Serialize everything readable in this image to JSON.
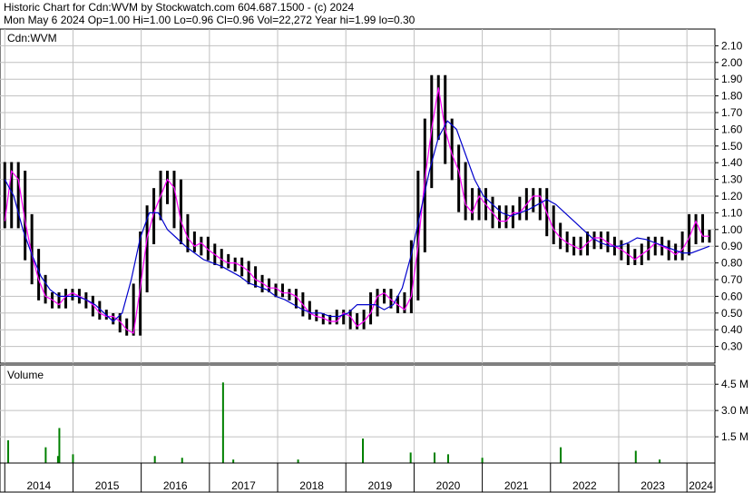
{
  "header": {
    "line1": "Historic Chart for Cdn:WVM by Stockwatch.com 604.687.1500 - (c) 2024",
    "line2": "Mon May  6 2024  Op=1.00  Hi=1.00  Lo=0.96  Cl=0.96  Vol=22,272  Year hi=1.99  lo=0.30"
  },
  "colors": {
    "price_bar": "#000000",
    "ma_short": "#ff00ff",
    "ma_long": "#0000cc",
    "last_price_segment": "#ff0000",
    "volume_default": "#008000",
    "grid": "#c0c0c0"
  },
  "chart_data": [
    {
      "type": "line",
      "label": "Cdn:WVM",
      "ylim": [
        0.2,
        2.2
      ],
      "y_ticks": [
        "2.10",
        "2.00",
        "1.90",
        "1.80",
        "1.70",
        "1.60",
        "1.50",
        "1.40",
        "1.30",
        "1.20",
        "1.10",
        "1.00",
        "0.90",
        "0.80",
        "0.70",
        "0.60",
        "0.50",
        "0.40",
        "0.30"
      ],
      "x_ticks": [
        "2014",
        "2015",
        "2016",
        "2017",
        "2018",
        "2019",
        "2020",
        "2021",
        "2022",
        "2023",
        "2024"
      ],
      "x": [
        2014.0,
        2014.08,
        2014.17,
        2014.25,
        2014.33,
        2014.42,
        2014.5,
        2014.58,
        2014.67,
        2014.75,
        2014.83,
        2014.92,
        2015.0,
        2015.08,
        2015.17,
        2015.25,
        2015.33,
        2015.42,
        2015.5,
        2015.58,
        2015.67,
        2015.75,
        2015.83,
        2015.92,
        2016.0,
        2016.08,
        2016.17,
        2016.25,
        2016.33,
        2016.42,
        2016.5,
        2016.58,
        2016.67,
        2016.75,
        2016.83,
        2016.92,
        2017.0,
        2017.08,
        2017.17,
        2017.25,
        2017.33,
        2017.42,
        2017.5,
        2017.58,
        2017.67,
        2017.75,
        2017.83,
        2017.92,
        2018.0,
        2018.08,
        2018.17,
        2018.25,
        2018.33,
        2018.42,
        2018.5,
        2018.58,
        2018.67,
        2018.75,
        2018.83,
        2018.92,
        2019.0,
        2019.08,
        2019.17,
        2019.25,
        2019.33,
        2019.42,
        2019.5,
        2019.58,
        2019.67,
        2019.75,
        2019.83,
        2019.92,
        2020.0,
        2020.08,
        2020.17,
        2020.25,
        2020.33,
        2020.42,
        2020.5,
        2020.58,
        2020.67,
        2020.75,
        2020.83,
        2020.92,
        2021.0,
        2021.08,
        2021.17,
        2021.25,
        2021.33,
        2021.42,
        2021.5,
        2021.58,
        2021.67,
        2021.75,
        2021.83,
        2021.92,
        2022.0,
        2022.08,
        2022.17,
        2022.25,
        2022.33,
        2022.42,
        2022.5,
        2022.58,
        2022.67,
        2022.75,
        2022.83,
        2022.92,
        2023.0,
        2023.08,
        2023.17,
        2023.25,
        2023.33,
        2023.42,
        2023.5,
        2023.58,
        2023.67,
        2023.75,
        2023.83,
        2023.92,
        2024.0,
        2024.08,
        2024.17,
        2024.25,
        2024.33
      ],
      "series": [
        {
          "values": [
            1.05,
            1.35,
            1.3,
            1.05,
            0.85,
            0.7,
            0.6,
            0.58,
            0.55,
            0.6,
            0.62,
            0.6,
            0.58,
            0.55,
            0.5,
            0.48,
            0.48,
            0.45,
            0.4,
            0.38,
            0.65,
            0.95,
            1.1,
            1.2,
            1.3,
            1.25,
            1.05,
            0.95,
            0.9,
            0.92,
            0.88,
            0.85,
            0.82,
            0.8,
            0.8,
            0.78,
            0.75,
            0.7,
            0.68,
            0.65,
            0.65,
            0.62,
            0.62,
            0.6,
            0.55,
            0.5,
            0.48,
            0.47,
            0.45,
            0.45,
            0.5,
            0.48,
            0.42,
            0.45,
            0.5,
            0.6,
            0.62,
            0.58,
            0.55,
            0.52,
            0.6,
            0.9,
            1.3,
            1.6,
            1.85,
            1.6,
            1.45,
            1.35,
            1.15,
            1.1,
            1.2,
            1.15,
            1.1,
            1.05,
            1.05,
            1.1,
            1.1,
            1.15,
            1.2,
            1.2,
            1.1,
            1.0,
            0.95,
            0.92,
            0.9,
            0.88,
            0.92,
            0.95,
            0.95,
            0.92,
            0.9,
            0.88,
            0.85,
            0.82,
            0.85,
            0.88,
            0.92,
            0.9,
            0.88,
            0.85,
            0.88,
            0.95,
            1.05,
            0.96,
            0.96
          ]
        },
        {
          "values": [
            1.3,
            1.2,
            1.0,
            0.85,
            0.72,
            0.64,
            0.6,
            0.6,
            0.6,
            0.58,
            0.55,
            0.5,
            0.45,
            0.5,
            0.7,
            0.95,
            1.1,
            1.1,
            1.0,
            0.95,
            0.9,
            0.86,
            0.82,
            0.8,
            0.78,
            0.75,
            0.72,
            0.68,
            0.66,
            0.64,
            0.6,
            0.58,
            0.55,
            0.52,
            0.5,
            0.5,
            0.48,
            0.48,
            0.5,
            0.55,
            0.55,
            0.55,
            0.52,
            0.55,
            0.65,
            0.85,
            1.1,
            1.35,
            1.55,
            1.65,
            1.6,
            1.45,
            1.3,
            1.2,
            1.15,
            1.1,
            1.08,
            1.1,
            1.12,
            1.15,
            1.18,
            1.15,
            1.1,
            1.05,
            1.0,
            0.95,
            0.92,
            0.9,
            0.9,
            0.92,
            0.95,
            0.94,
            0.92,
            0.9,
            0.88,
            0.86,
            0.86,
            0.88,
            0.9
          ]
        }
      ]
    },
    {
      "type": "bar",
      "label": "Volume",
      "ylim": [
        0,
        5.6
      ],
      "y_ticks": [
        "4.5 M",
        "3.0 M",
        "1.5 M"
      ],
      "x_ticks": [
        "2014",
        "2015",
        "2016",
        "2017",
        "2018",
        "2019",
        "2020",
        "2021",
        "2022",
        "2023",
        "2024"
      ],
      "x": [
        2014.05,
        2014.6,
        2014.78,
        2014.8,
        2015.0,
        2016.2,
        2016.6,
        2017.2,
        2017.35,
        2018.3,
        2019.25,
        2019.95,
        2020.3,
        2020.5,
        2021.0,
        2022.15,
        2023.25,
        2023.6
      ],
      "values": [
        1.3,
        0.9,
        0.4,
        2.0,
        0.5,
        0.4,
        0.3,
        4.6,
        0.2,
        0.2,
        1.4,
        0.6,
        0.6,
        0.5,
        0.3,
        0.9,
        0.7,
        0.2
      ]
    }
  ]
}
